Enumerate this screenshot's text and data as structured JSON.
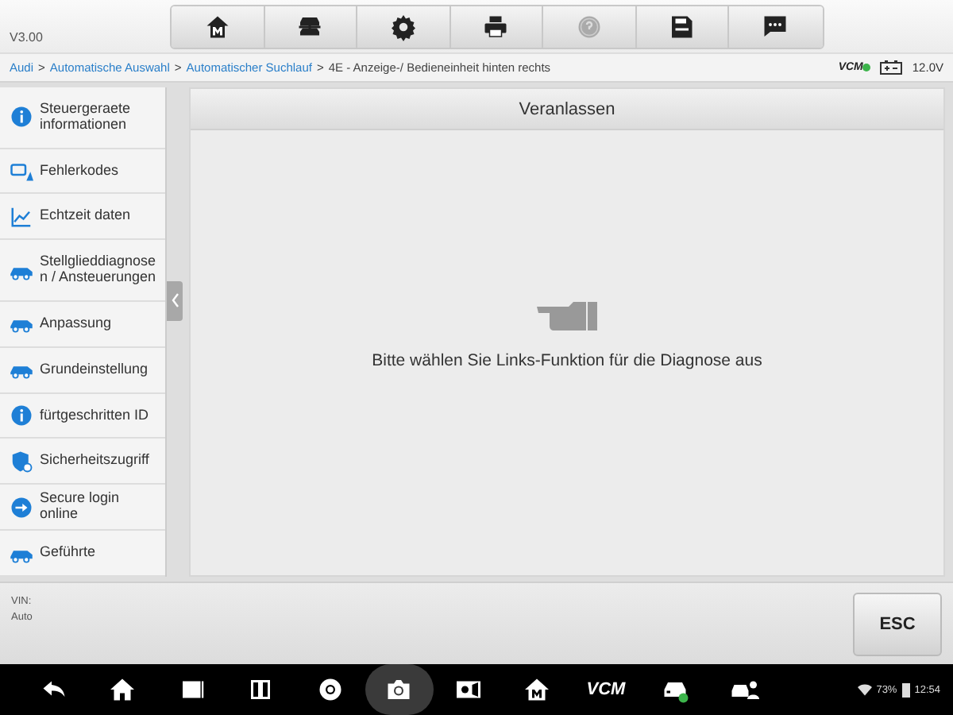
{
  "version": "V3.00",
  "toolbar": [
    {
      "kind": "home",
      "disabled": false
    },
    {
      "kind": "lift",
      "disabled": false
    },
    {
      "kind": "settings",
      "disabled": false
    },
    {
      "kind": "print",
      "disabled": false
    },
    {
      "kind": "help",
      "disabled": true
    },
    {
      "kind": "save",
      "disabled": false
    },
    {
      "kind": "chat",
      "disabled": false
    }
  ],
  "breadcrumb": {
    "separator": ">",
    "items": [
      {
        "label": "Audi",
        "current": false
      },
      {
        "label": "Automatische Auswahl",
        "current": false
      },
      {
        "label": "Automatischer Suchlauf",
        "current": false
      },
      {
        "label": "4E - Anzeige-/ Bedieneinheit hinten rechts",
        "current": true
      }
    ]
  },
  "status": {
    "vcm": "VCM",
    "voltage": "12.0V"
  },
  "sidebar": {
    "items": [
      {
        "label": "Steuergeraete informationen",
        "kind": "info",
        "selected": false
      },
      {
        "label": "Fehlerkodes",
        "kind": "dtc",
        "selected": false
      },
      {
        "label": "Echtzeit daten",
        "kind": "chart",
        "selected": false
      },
      {
        "label": "Stellglieddiagnosen / Ansteuerungen",
        "kind": "car",
        "selected": false
      },
      {
        "label": "Anpassung",
        "kind": "car",
        "selected": false
      },
      {
        "label": "Grundeinstellung",
        "kind": "car",
        "selected": false
      },
      {
        "label": "fürtgeschritten ID",
        "kind": "info",
        "selected": false
      },
      {
        "label": "Sicherheitszugriff",
        "kind": "shield",
        "selected": false
      },
      {
        "label": "Secure login online",
        "kind": "login",
        "selected": false
      },
      {
        "label": "Geführte",
        "kind": "car",
        "selected": false
      }
    ]
  },
  "panel": {
    "title": "Veranlassen",
    "message": "Bitte wählen Sie Links-Funktion für die Diagnose aus"
  },
  "footer": {
    "vin": "VIN:",
    "vehicle": "Auto",
    "esc": "ESC"
  },
  "navbar": {
    "items": [
      {
        "kind": "back",
        "selected": false
      },
      {
        "kind": "home",
        "selected": false
      },
      {
        "kind": "recent",
        "selected": false
      },
      {
        "kind": "split",
        "selected": false
      },
      {
        "kind": "browser",
        "selected": false
      },
      {
        "kind": "camera",
        "selected": true
      },
      {
        "kind": "brightness",
        "selected": false
      },
      {
        "kind": "mlogo",
        "selected": false
      },
      {
        "kind": "vcm",
        "selected": false
      },
      {
        "kind": "car",
        "selected": false
      },
      {
        "kind": "carperson",
        "selected": false
      }
    ],
    "vcm": "VCM",
    "battery": "73%",
    "time": "12:54"
  }
}
